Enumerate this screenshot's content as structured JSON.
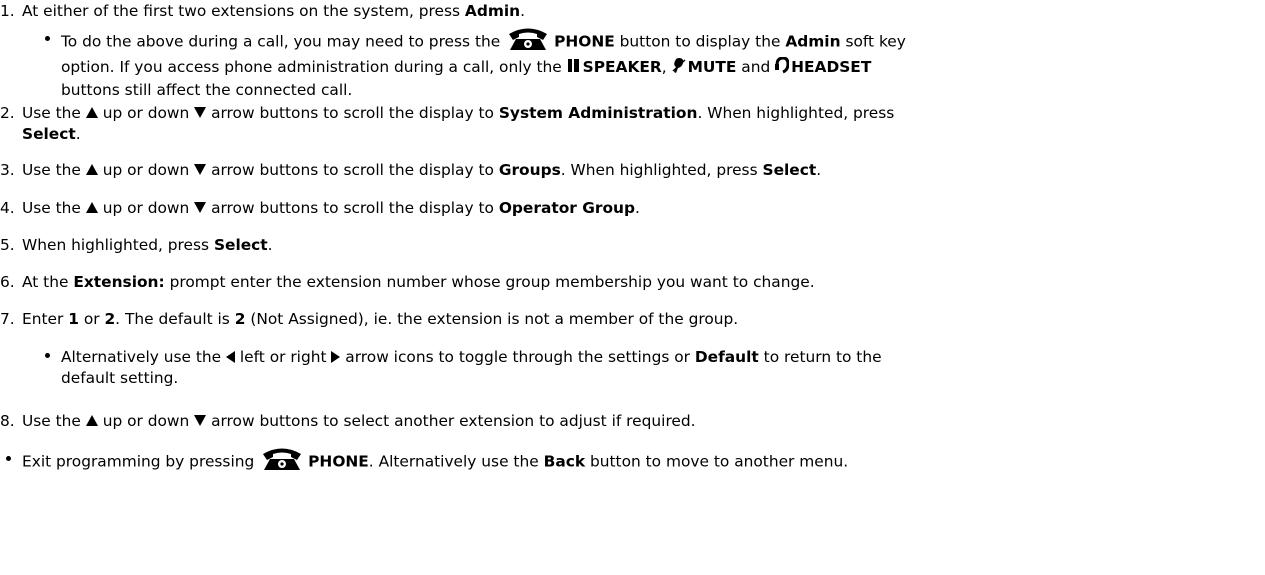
{
  "steps": {
    "s1": {
      "num": "1.",
      "t1": "At either of the first two extensions on the system, press ",
      "b1": "Admin",
      "t2": "."
    },
    "s1_sub": {
      "l1_t1": "To do the above during a call, you may need to press the ",
      "l1_b1": "PHONE",
      "l1_t2": " button to display the ",
      "l1_b2": "Admin",
      "l1_t3": " soft key",
      "l2_t1": "option. If you access phone administration during a call, only the ",
      "l2_b1": "SPEAKER",
      "l2_t2": ", ",
      "l2_b2": "MUTE",
      "l2_t3": " and ",
      "l2_b3": "HEADSET",
      "l3_t1": "buttons still affect the connected call."
    },
    "s2": {
      "num": "2.",
      "t1": "Use the ",
      "t2": " up or down ",
      "t3": " arrow buttons to scroll the display to ",
      "b1": "System Administration",
      "t4": ". When highlighted, press",
      "b2": "Select",
      "t5": "."
    },
    "s3": {
      "num": "3.",
      "t1": "Use the ",
      "t2": " up or down ",
      "t3": " arrow buttons to scroll the display to ",
      "b1": "Groups",
      "t4": ". When highlighted, press ",
      "b2": "Select",
      "t5": "."
    },
    "s4": {
      "num": "4.",
      "t1": "Use the ",
      "t2": " up or down ",
      "t3": " arrow buttons to scroll the display to ",
      "b1": "Operator Group",
      "t4": "."
    },
    "s5": {
      "num": "5.",
      "t1": "When highlighted, press ",
      "b1": "Select",
      "t2": "."
    },
    "s6": {
      "num": "6.",
      "t1": "At the ",
      "b1": "Extension:",
      "t2": " prompt enter the extension number whose group membership you want to change."
    },
    "s7": {
      "num": "7.",
      "t1": "Enter ",
      "b1": "1",
      "t2": " or ",
      "b2": "2",
      "t3": ". The default is ",
      "b3": "2",
      "t4": " (Not Assigned), ie. the extension is not a member of the group."
    },
    "s7_sub": {
      "t1": "Alternatively use the ",
      "t2": " left or right ",
      "t3": " arrow icons to toggle through the settings or ",
      "b1": "Default",
      "t4": " to return to the",
      "l2": "default setting."
    },
    "s8": {
      "num": "8.",
      "t1": "Use the ",
      "t2": " up or down ",
      "t3": " arrow buttons to select another extension to adjust if required."
    },
    "exit": {
      "t1": "Exit programming by pressing ",
      "b1": "PHONE",
      "t2": ". Alternatively use the ",
      "b2": "Back",
      "t3": " button to move to another menu."
    }
  },
  "icons": [
    "phone-icon",
    "speaker-icon",
    "mute-icon",
    "headset-icon",
    "arrow-up-icon",
    "arrow-down-icon",
    "arrow-left-icon",
    "arrow-right-icon"
  ]
}
